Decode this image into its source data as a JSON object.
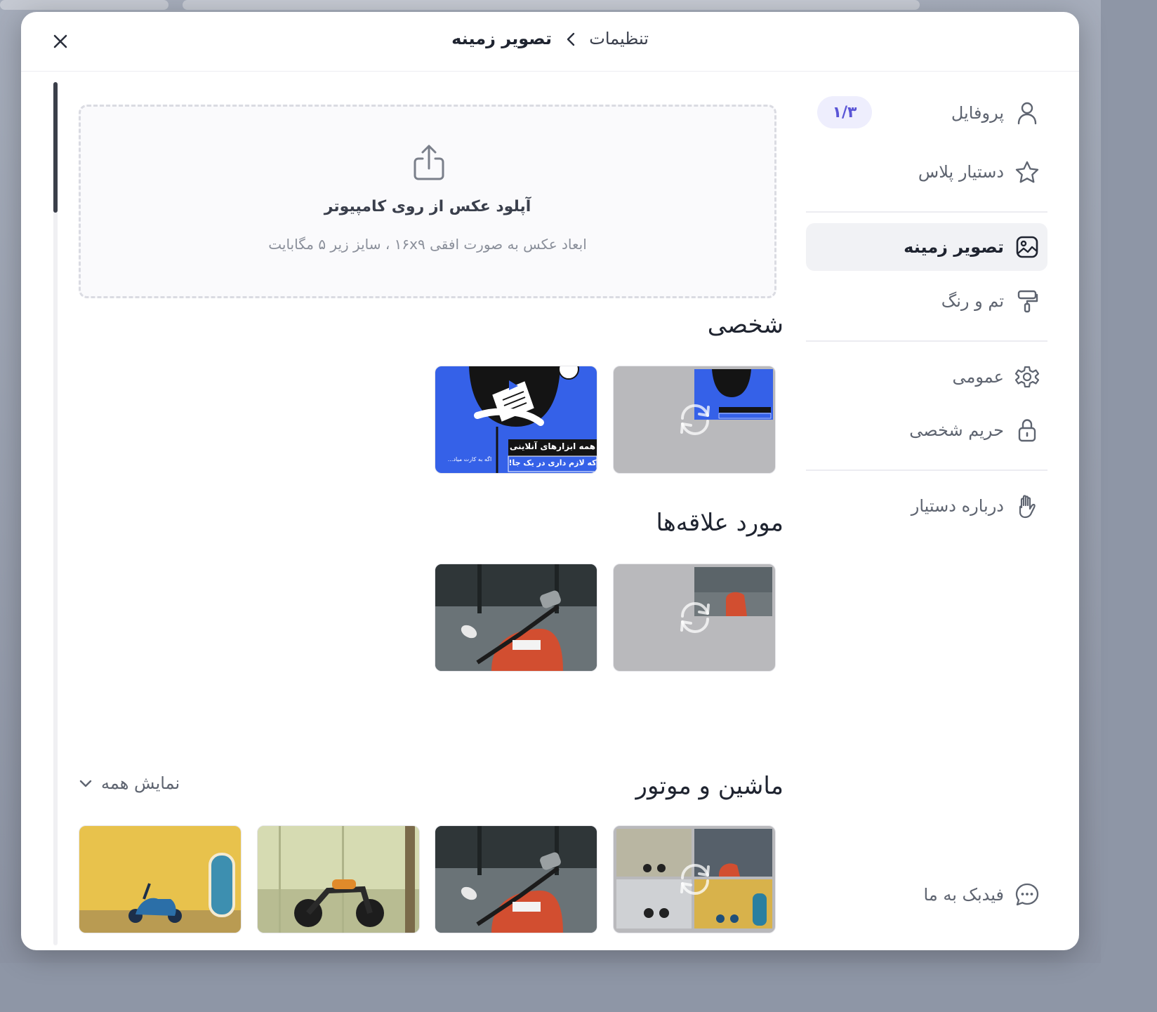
{
  "header": {
    "breadcrumb_root": "تنظیمات",
    "breadcrumb_current": "تصویر زمینه"
  },
  "sidebar": {
    "items": [
      {
        "label": "پروفایل",
        "icon": "user-icon",
        "badge": "۱/۳"
      },
      {
        "label": "دستیار پلاس",
        "icon": "star-icon"
      },
      {
        "label": "تصویر زمینه",
        "icon": "image-icon",
        "active": true
      },
      {
        "label": "تم و رنگ",
        "icon": "paint-roller-icon"
      },
      {
        "label": "عمومی",
        "icon": "gear-icon"
      },
      {
        "label": "حریم شخصی",
        "icon": "lock-icon"
      },
      {
        "label": "درباره دستیار",
        "icon": "hand-icon"
      }
    ],
    "feedback_label": "فیدبک به ما"
  },
  "upload": {
    "title": "آپلود عکس از روی کامپیوتر",
    "hint": "ابعاد عکس به صورت افقی ۱۶x۹ ، سایز زیر ۵ مگابایت"
  },
  "sections": {
    "personal": {
      "title": "شخصی",
      "promo_line1": "همه ابزارهای آنلاینی",
      "promo_line2": "که لازم داری در یک جا!",
      "promo_small": "اگه به کارت میاد..."
    },
    "favorites": {
      "title": "مورد علاقه‌ها"
    },
    "cars_motors": {
      "title": "ماشین و موتور",
      "show_all": "نمایش همه"
    }
  },
  "colors": {
    "accent": "#5a55d6",
    "badge_bg": "#eeeefd",
    "active_nav_bg": "#f1f2f5",
    "promo_blue": "#3561e8"
  }
}
